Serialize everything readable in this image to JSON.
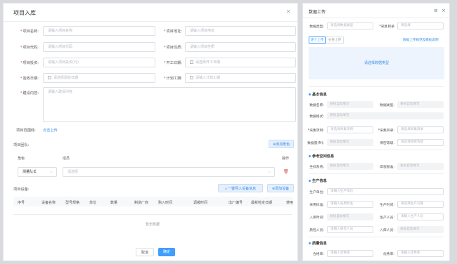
{
  "left": {
    "title": "项目入库",
    "close": "×",
    "fields": {
      "name": {
        "label": "项目名称:",
        "placeholder": "请输入项目名称"
      },
      "code": {
        "label": "项目代码:",
        "placeholder": "请输入项目代码"
      },
      "invest": {
        "label": "项目投资:",
        "placeholder": "请输入项目投资(元)"
      },
      "accept": {
        "label": "验收日期:",
        "placeholder": "请选择验收日期"
      },
      "content": {
        "label": "建设内容:",
        "placeholder": "请输入建设内容"
      },
      "addr": {
        "label": "项目地址:",
        "placeholder": "请输入项目地址"
      },
      "nature": {
        "label": "项目性质:",
        "placeholder": "请输入项目性质"
      },
      "start": {
        "label": "开工日期:",
        "placeholder": "请选择开工日期"
      },
      "plan": {
        "label": "计划工期:",
        "placeholder": "请输入计划工期"
      }
    },
    "scope": {
      "label": "项目范围线:",
      "link": "点击上传"
    },
    "team": {
      "label": "项目团队:",
      "add_role": "⊕添加角色",
      "col_role": "角色",
      "col_member": "成员",
      "col_op": "操作",
      "row_role": "测量队长",
      "row_member_placeholder": "请选择"
    },
    "equip": {
      "label": "项目设备:",
      "import": "↙一键导入设备信息",
      "add": "⊕添加设备",
      "columns": [
        "序号",
        "设备名称",
        "型号规格",
        "单位",
        "数量",
        "制造厂商",
        "购入时间",
        "调拨时间",
        "出厂编号",
        "最新检定日期",
        "使用"
      ],
      "empty": "暂无数据"
    },
    "cancel": "取消",
    "confirm": "确定"
  },
  "right": {
    "title": "数据上传",
    "type": {
      "label": "数据类型:",
      "placeholder": "请选择数据类型"
    },
    "dir": {
      "label": "*采集目录",
      "placeholder": "请选择"
    },
    "tabs": [
      "逐个上传",
      "分卷上传"
    ],
    "link": "数据上传规范及模板说明",
    "upload_prompt": "请选择数据类型",
    "basic": {
      "title": "基本信息",
      "rows": [
        {
          "l1": "数据名称:",
          "p1": "系统自动填写",
          "l2": "数据类型:",
          "p2": "系统自动填写"
        },
        {
          "l1": "数据格式:",
          "p1": "系统自动填写"
        },
        {
          "l1": "*采集项目:",
          "p1": "请选择采集项目",
          "l2": "*采集目录:",
          "p2": "请选择采集目录"
        },
        {
          "l1": "数据量(M):",
          "p1": "系统自动填写",
          "l2": "保密等级:",
          "p2": "请选择保密等级"
        }
      ]
    },
    "ref": {
      "title": "参考空间信息",
      "l1": "坐标系统:",
      "p1": "系统自动填写",
      "l2": "高程基准:",
      "p2": "系统自动填写"
    },
    "prod": {
      "title": "生产信息",
      "unit": {
        "label": "生产单位:",
        "placeholder": "请输入生产单位"
      },
      "std": {
        "label": "采用标准:",
        "placeholder": "请输入采用标准",
        "l2": "生产时间:",
        "p2": "请选择生产日期"
      },
      "in": {
        "label": "入库时间:",
        "placeholder": "系统自动填写",
        "l2": "生产人员:",
        "p2": "请输入生产人员"
      },
      "pm": {
        "label": "质检人员:",
        "placeholder": "请输入质检人员",
        "l2": "入库人员:",
        "p2": "系统自动填写"
      }
    },
    "check": {
      "title": "质量信息",
      "l1": "合格率:",
      "p1": "请输入合格率",
      "l2": "优秀率:",
      "p2": "请输入优秀率"
    }
  }
}
